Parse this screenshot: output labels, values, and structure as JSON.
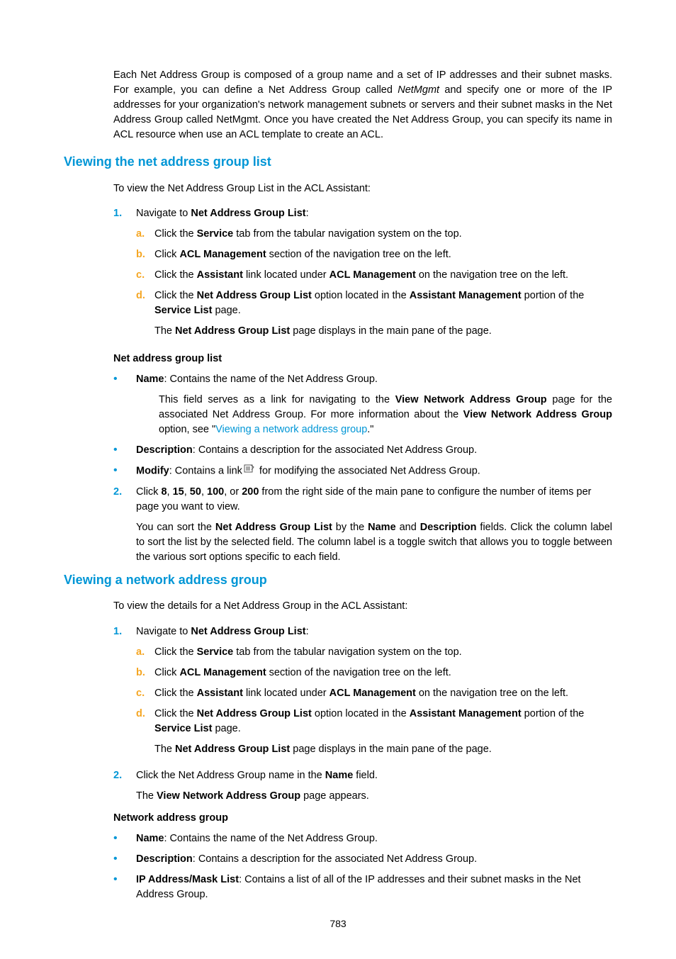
{
  "intro": {
    "part1": "Each Net Address Group is composed of a group name and a set of IP addresses and their subnet masks. For example, you can define a Net Address Group called ",
    "italic": "NetMgmt",
    "part2": " and specify one or more of the IP addresses for your organization's network management subnets or servers and their subnet masks in the Net Address Group called NetMgmt. Once you have created the Net Address Group, you can specify its name in ACL resource when use an ACL template to create an ACL."
  },
  "section1": {
    "heading": "Viewing the net address group list",
    "intro": "To view the Net Address Group List in the ACL Assistant:",
    "step1": {
      "num": "1.",
      "prefix": "Navigate to ",
      "bold": "Net Address Group List",
      "suffix": ":",
      "a": {
        "letter": "a.",
        "p1": "Click the ",
        "b1": "Service",
        "p2": " tab from the tabular navigation system on the top."
      },
      "b": {
        "letter": "b.",
        "p1": "Click ",
        "b1": "ACL Management",
        "p2": " section of the navigation tree on the left."
      },
      "c": {
        "letter": "c.",
        "p1": "Click the ",
        "b1": "Assistant",
        "p2": " link located under ",
        "b2": "ACL Management",
        "p3": " on the navigation tree on the left."
      },
      "d": {
        "letter": "d.",
        "p1": "Click the ",
        "b1": "Net Address Group List",
        "p2": " option located in the ",
        "b2": "Assistant Management",
        "p3": " portion of the ",
        "b3": "Service List",
        "p4": " page."
      },
      "result": {
        "p1": "The ",
        "b1": "Net Address Group List",
        "p2": " page displays in the main pane of the page."
      }
    },
    "listTitle": "Net address group list",
    "bullets": {
      "name": {
        "b1": "Name",
        "p1": ": Contains the name of the Net Address Group."
      },
      "nameDetail": {
        "p1": "This field serves as a link for navigating to the ",
        "b1": "View Network Address Group",
        "p2": " page for the associated Net Address Group. For more information about the ",
        "b2": "View Network Address Group",
        "p3": " option, see \"",
        "link": "Viewing a network address group",
        "p4": ".\""
      },
      "desc": {
        "b1": "Description",
        "p1": ": Contains a description for the associated Net Address Group."
      },
      "modify": {
        "b1": "Modify",
        "p1": ": Contains a link",
        "p2": " for modifying the associated Net Address Group."
      }
    },
    "step2": {
      "num": "2.",
      "p1": "Click ",
      "b1": "8",
      "c1": ", ",
      "b2": "15",
      "c2": ", ",
      "b3": "50",
      "c3": ", ",
      "b4": "100",
      "c4": ", or ",
      "b5": "200",
      "p2": " from the right side of the main pane to configure the number of items per page you want to view.",
      "detail": {
        "p1": "You can sort the ",
        "b1": "Net Address Group List",
        "p2": " by the ",
        "b2": "Name",
        "p3": " and ",
        "b3": "Description",
        "p4": " fields. Click the column label to sort the list by the selected field. The column label is a toggle switch that allows you to toggle between the various sort options specific to each field."
      }
    }
  },
  "section2": {
    "heading": "Viewing a network address group",
    "intro": "To view the details for a Net Address Group in the ACL Assistant:",
    "step1": {
      "num": "1.",
      "prefix": "Navigate to ",
      "bold": "Net Address Group List",
      "suffix": ":",
      "a": {
        "letter": "a.",
        "p1": "Click the ",
        "b1": "Service",
        "p2": " tab from the tabular navigation system on the top."
      },
      "b": {
        "letter": "b.",
        "p1": "Click ",
        "b1": "ACL Management",
        "p2": " section of the navigation tree on the left."
      },
      "c": {
        "letter": "c.",
        "p1": "Click the ",
        "b1": "Assistant",
        "p2": " link located under ",
        "b2": "ACL Management",
        "p3": " on the navigation tree on the left."
      },
      "d": {
        "letter": "d.",
        "p1": "Click the ",
        "b1": "Net Address Group List",
        "p2": " option located in the ",
        "b2": "Assistant Management",
        "p3": " portion of the ",
        "b3": "Service List",
        "p4": " page."
      },
      "result": {
        "p1": "The ",
        "b1": "Net Address Group List",
        "p2": " page displays in the main pane of the page."
      }
    },
    "step2": {
      "num": "2.",
      "p1": "Click the Net Address Group name in the ",
      "b1": "Name",
      "p2": " field.",
      "result": {
        "p1": "The ",
        "b1": "View Network Address Group",
        "p2": " page appears."
      }
    },
    "listTitle": "Network address group",
    "bullets": {
      "name": {
        "b1": "Name",
        "p1": ": Contains the name of the Net Address Group."
      },
      "desc": {
        "b1": "Description",
        "p1": ": Contains a description for the associated Net Address Group."
      },
      "ipmask": {
        "b1": "IP Address/Mask List",
        "p1": ": Contains a list of all of the IP addresses and their subnet masks in the Net Address Group."
      }
    }
  },
  "pageNumber": "783"
}
